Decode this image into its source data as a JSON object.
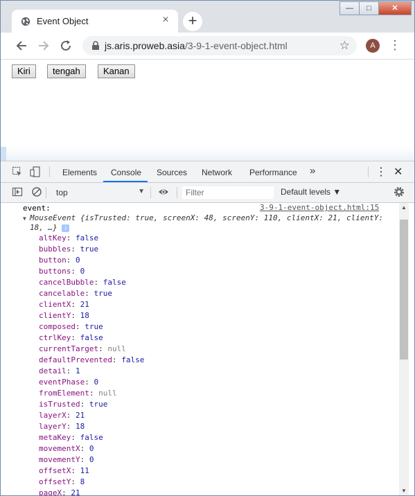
{
  "browser": {
    "tab_title": "Event Object",
    "url_domain": "js.aris.proweb.asia",
    "url_path": "/3-9-1-event-object.html",
    "avatar_letter": "A",
    "window_controls": {
      "minimize": "—",
      "maximize": "□",
      "close": "✕"
    }
  },
  "page": {
    "buttons": [
      {
        "label": "Kiri"
      },
      {
        "label": "tengah"
      },
      {
        "label": "Kanan"
      }
    ]
  },
  "devtools": {
    "tabs": [
      "Elements",
      "Console",
      "Sources",
      "Network",
      "Performance"
    ],
    "active_tab": "Console",
    "more_tabs": "»",
    "context": "top",
    "filter_placeholder": "Filter",
    "levels": "Default levels ▼"
  },
  "console": {
    "log_label": "event:",
    "source_link": "3-9-1-event-object.html:15",
    "preview_line1": "MouseEvent {isTrusted: true, screenX: 48, screenY: 110, clientX: 21, clientY:",
    "preview_line2": "18, …}",
    "info_badge": "i",
    "properties": [
      {
        "key": "altKey",
        "value": "false",
        "type": "bool"
      },
      {
        "key": "bubbles",
        "value": "true",
        "type": "bool"
      },
      {
        "key": "button",
        "value": "0",
        "type": "num"
      },
      {
        "key": "buttons",
        "value": "0",
        "type": "num"
      },
      {
        "key": "cancelBubble",
        "value": "false",
        "type": "bool"
      },
      {
        "key": "cancelable",
        "value": "true",
        "type": "bool"
      },
      {
        "key": "clientX",
        "value": "21",
        "type": "num"
      },
      {
        "key": "clientY",
        "value": "18",
        "type": "num"
      },
      {
        "key": "composed",
        "value": "true",
        "type": "bool"
      },
      {
        "key": "ctrlKey",
        "value": "false",
        "type": "bool"
      },
      {
        "key": "currentTarget",
        "value": "null",
        "type": "null"
      },
      {
        "key": "defaultPrevented",
        "value": "false",
        "type": "bool"
      },
      {
        "key": "detail",
        "value": "1",
        "type": "num"
      },
      {
        "key": "eventPhase",
        "value": "0",
        "type": "num"
      },
      {
        "key": "fromElement",
        "value": "null",
        "type": "null"
      },
      {
        "key": "isTrusted",
        "value": "true",
        "type": "bool"
      },
      {
        "key": "layerX",
        "value": "21",
        "type": "num"
      },
      {
        "key": "layerY",
        "value": "18",
        "type": "num"
      },
      {
        "key": "metaKey",
        "value": "false",
        "type": "bool"
      },
      {
        "key": "movementX",
        "value": "0",
        "type": "num"
      },
      {
        "key": "movementY",
        "value": "0",
        "type": "num"
      },
      {
        "key": "offsetX",
        "value": "11",
        "type": "num"
      },
      {
        "key": "offsetY",
        "value": "8",
        "type": "num"
      },
      {
        "key": "pageX",
        "value": "21",
        "type": "num"
      }
    ]
  }
}
